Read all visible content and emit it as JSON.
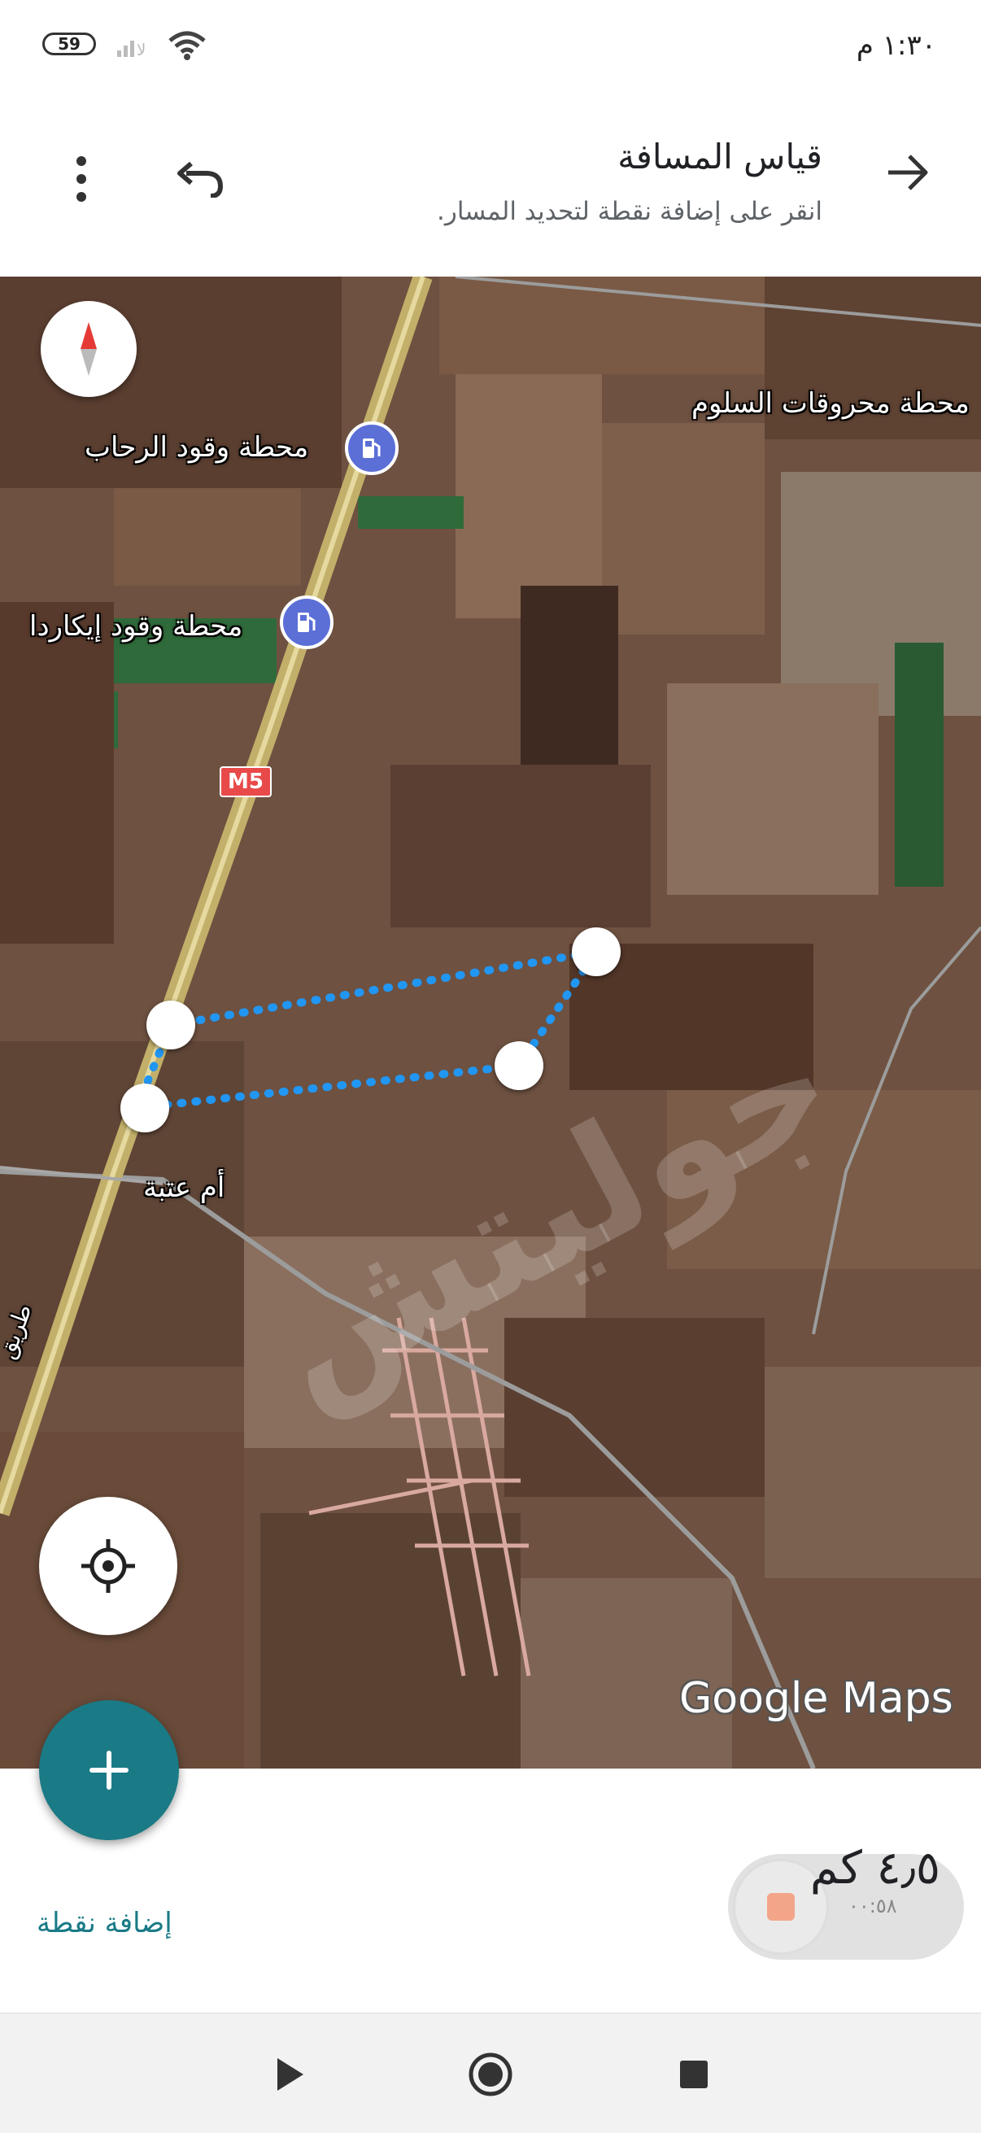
{
  "status_bar": {
    "time": "١:٣٠ م",
    "battery": "59",
    "signal_label": "لا"
  },
  "header": {
    "title": "قياس المسافة",
    "subtitle": "انقر على إضافة نقطة لتحديد المسار.",
    "back_icon": "arrow-forward-icon",
    "undo_icon": "undo-icon",
    "more_icon": "more-vert-icon"
  },
  "map": {
    "labels": {
      "fuel_station_1": "محطة وقود الرحاب",
      "fuel_station_2": "محطة وقود إيكاردا",
      "fuel_station_3": "محطة محروقات السلوم",
      "village": "أم عتبة",
      "road_name": "طريق"
    },
    "road_shield": "M5",
    "attribution": "Google Maps",
    "watermark": "جوليتش",
    "route_color": "#2196f3"
  },
  "bottom_sheet": {
    "distance": "٤٫٥ كم",
    "add_point": "إضافة نقطة",
    "recorder_time": "٠٠:٥٨"
  },
  "colors": {
    "accent": "#1a7a86",
    "poi": "#5b6fd6"
  }
}
